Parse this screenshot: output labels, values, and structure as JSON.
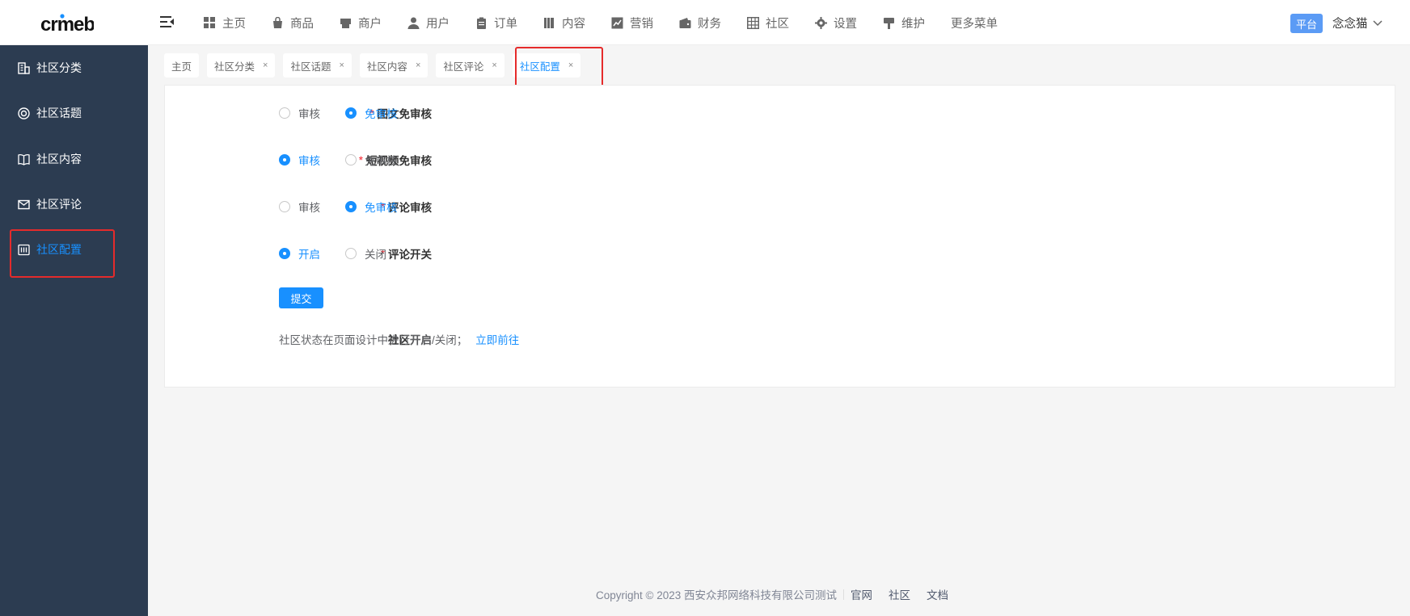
{
  "app": {
    "logo_text": "crmeb"
  },
  "topnav": {
    "items": [
      {
        "label": "主页",
        "icon": "grid-icon"
      },
      {
        "label": "商品",
        "icon": "bag-icon"
      },
      {
        "label": "商户",
        "icon": "store-icon"
      },
      {
        "label": "用户",
        "icon": "user-icon"
      },
      {
        "label": "订单",
        "icon": "clipboard-icon"
      },
      {
        "label": "内容",
        "icon": "book-icon"
      },
      {
        "label": "营销",
        "icon": "chart-icon"
      },
      {
        "label": "财务",
        "icon": "wallet-icon"
      },
      {
        "label": "社区",
        "icon": "table-icon"
      },
      {
        "label": "设置",
        "icon": "gear-icon"
      },
      {
        "label": "维护",
        "icon": "brush-icon"
      },
      {
        "label": "更多菜单",
        "icon": ""
      }
    ],
    "platform_badge": "平台",
    "user_name": "念念猫"
  },
  "sidebar": {
    "items": [
      {
        "label": "社区分类",
        "icon": "building-icon",
        "active": false
      },
      {
        "label": "社区话题",
        "icon": "lifebuoy-icon",
        "active": false
      },
      {
        "label": "社区内容",
        "icon": "open-book-icon",
        "active": false
      },
      {
        "label": "社区评论",
        "icon": "mail-icon",
        "active": false
      },
      {
        "label": "社区配置",
        "icon": "config-icon",
        "active": true
      }
    ]
  },
  "tabs": [
    {
      "label": "主页",
      "closable": false,
      "active": false
    },
    {
      "label": "社区分类",
      "closable": true,
      "active": false
    },
    {
      "label": "社区话题",
      "closable": true,
      "active": false
    },
    {
      "label": "社区内容",
      "closable": true,
      "active": false
    },
    {
      "label": "社区评论",
      "closable": true,
      "active": false
    },
    {
      "label": "社区配置",
      "closable": true,
      "active": true
    }
  ],
  "tab_close_symbol": "×",
  "form": {
    "required_mark": "*",
    "fields": [
      {
        "label": "图文免审核",
        "options": [
          "审核",
          "免审核"
        ],
        "selected": "免审核"
      },
      {
        "label": "短视频免审核",
        "options": [
          "审核",
          "免审核"
        ],
        "selected": "审核"
      },
      {
        "label": "评论审核",
        "options": [
          "审核",
          "免审核"
        ],
        "selected": "免审核"
      },
      {
        "label": "评论开关",
        "options": [
          "开启",
          "关闭"
        ],
        "selected": "开启"
      }
    ],
    "submit_label": "提交",
    "community": {
      "label": "社区开启",
      "description": "社区状态在页面设计中进行开启/关闭；",
      "link": "立即前往"
    }
  },
  "footer": {
    "copyright": "Copyright © 2023 西安众邦网络科技有限公司测试",
    "links": [
      "官网",
      "社区",
      "文档"
    ]
  },
  "colors": {
    "accent": "#1890ff",
    "sidebar_bg": "#2c3c51",
    "highlight": "#e52b2b",
    "badge": "#5b9bf5"
  }
}
